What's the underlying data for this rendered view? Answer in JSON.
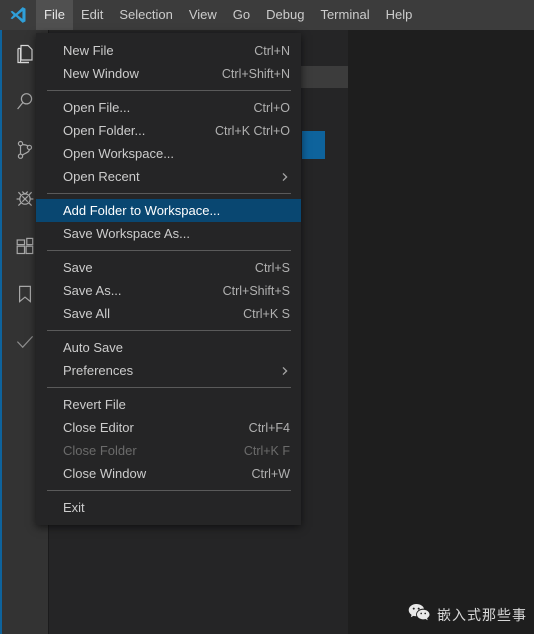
{
  "titlebar": {
    "logo_icon": "vscode-logo-icon",
    "menus": [
      {
        "label": "File",
        "active": true
      },
      {
        "label": "Edit",
        "active": false
      },
      {
        "label": "Selection",
        "active": false
      },
      {
        "label": "View",
        "active": false
      },
      {
        "label": "Go",
        "active": false
      },
      {
        "label": "Debug",
        "active": false
      },
      {
        "label": "Terminal",
        "active": false
      },
      {
        "label": "Help",
        "active": false
      }
    ]
  },
  "activitybar": {
    "items": [
      {
        "icon": "explorer-files-icon"
      },
      {
        "icon": "search-icon"
      },
      {
        "icon": "source-control-branch-icon"
      },
      {
        "icon": "debug-bug-icon"
      },
      {
        "icon": "extensions-blocks-icon"
      },
      {
        "icon": "bookmark-icon"
      },
      {
        "icon": "checkmark-icon"
      }
    ]
  },
  "file_menu": {
    "rows": [
      {
        "type": "item",
        "label": "New File",
        "shortcut": "Ctrl+N"
      },
      {
        "type": "item",
        "label": "New Window",
        "shortcut": "Ctrl+Shift+N"
      },
      {
        "type": "separator"
      },
      {
        "type": "item",
        "label": "Open File...",
        "shortcut": "Ctrl+O"
      },
      {
        "type": "item",
        "label": "Open Folder...",
        "shortcut": "Ctrl+K Ctrl+O"
      },
      {
        "type": "item",
        "label": "Open Workspace...",
        "shortcut": ""
      },
      {
        "type": "submenu",
        "label": "Open Recent",
        "shortcut": ""
      },
      {
        "type": "separator"
      },
      {
        "type": "item",
        "label": "Add Folder to Workspace...",
        "shortcut": "",
        "selected": true
      },
      {
        "type": "item",
        "label": "Save Workspace As...",
        "shortcut": ""
      },
      {
        "type": "separator"
      },
      {
        "type": "item",
        "label": "Save",
        "shortcut": "Ctrl+S"
      },
      {
        "type": "item",
        "label": "Save As...",
        "shortcut": "Ctrl+Shift+S"
      },
      {
        "type": "item",
        "label": "Save All",
        "shortcut": "Ctrl+K S"
      },
      {
        "type": "separator"
      },
      {
        "type": "item",
        "label": "Auto Save",
        "shortcut": ""
      },
      {
        "type": "submenu",
        "label": "Preferences",
        "shortcut": ""
      },
      {
        "type": "separator"
      },
      {
        "type": "item",
        "label": "Revert File",
        "shortcut": ""
      },
      {
        "type": "item",
        "label": "Close Editor",
        "shortcut": "Ctrl+F4"
      },
      {
        "type": "item",
        "label": "Close Folder",
        "shortcut": "Ctrl+K F",
        "disabled": true
      },
      {
        "type": "item",
        "label": "Close Window",
        "shortcut": "Ctrl+W"
      },
      {
        "type": "separator"
      },
      {
        "type": "item",
        "label": "Exit",
        "shortcut": ""
      }
    ]
  },
  "watermark": {
    "icon": "wechat-logo-icon",
    "text": "嵌入式那些事"
  },
  "colors": {
    "titlebar_bg": "#3c3c3c",
    "menubar_active_bg": "#505050",
    "activitybar_bg": "#333333",
    "sidebar_bg": "#252526",
    "editor_bg": "#1e1e1e",
    "menu_bg": "#252526",
    "menu_selected_bg": "#094771",
    "accent_blue": "#0e639c",
    "text": "#cccccc",
    "text_disabled": "#6b6b6b"
  }
}
